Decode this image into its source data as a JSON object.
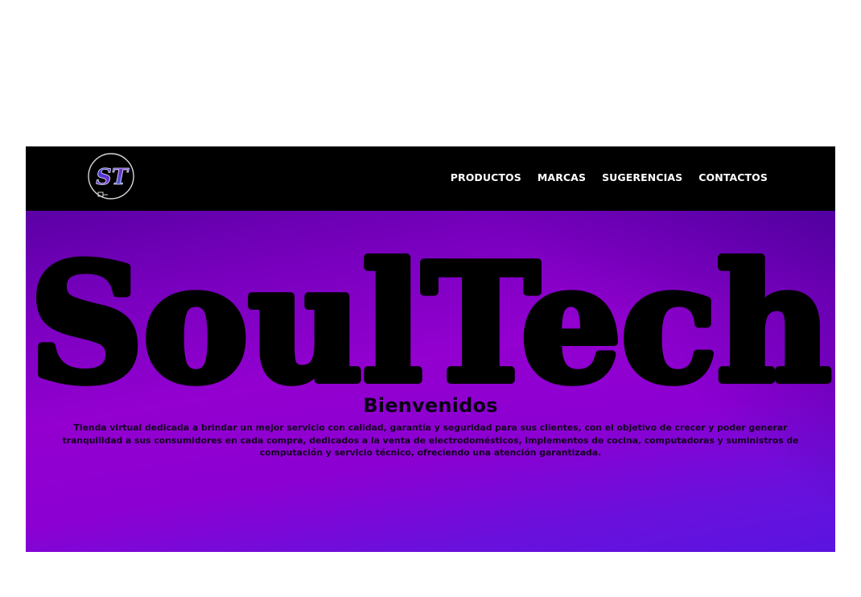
{
  "header": {
    "logo_text": "ST",
    "nav": [
      {
        "label": "PRODUCTOS"
      },
      {
        "label": "MARCAS"
      },
      {
        "label": "SUGERENCIAS"
      },
      {
        "label": "CONTACTOS"
      }
    ]
  },
  "hero": {
    "brand": "SoulTech",
    "heading": "Bienvenidos",
    "description": "Tienda virtual dedicada a brindar un mejor servicio con calidad, garantía y seguridad para sus clientes, con el objetivo de crecer y poder generar tranquilidad a sus consumidores en cada compra, dedicados a la venta de electrodomésticos, implementos de cocina, computadoras y suministros de computación y servicio técnico, ofreciendo una atención garantizada."
  },
  "colors": {
    "navbar": "#000000",
    "hero_top": "#5b00a6",
    "hero_mid": "#9300d0",
    "hero_bottom": "#5a14e0",
    "brand_text": "#000000",
    "nav_text": "#ffffff"
  }
}
